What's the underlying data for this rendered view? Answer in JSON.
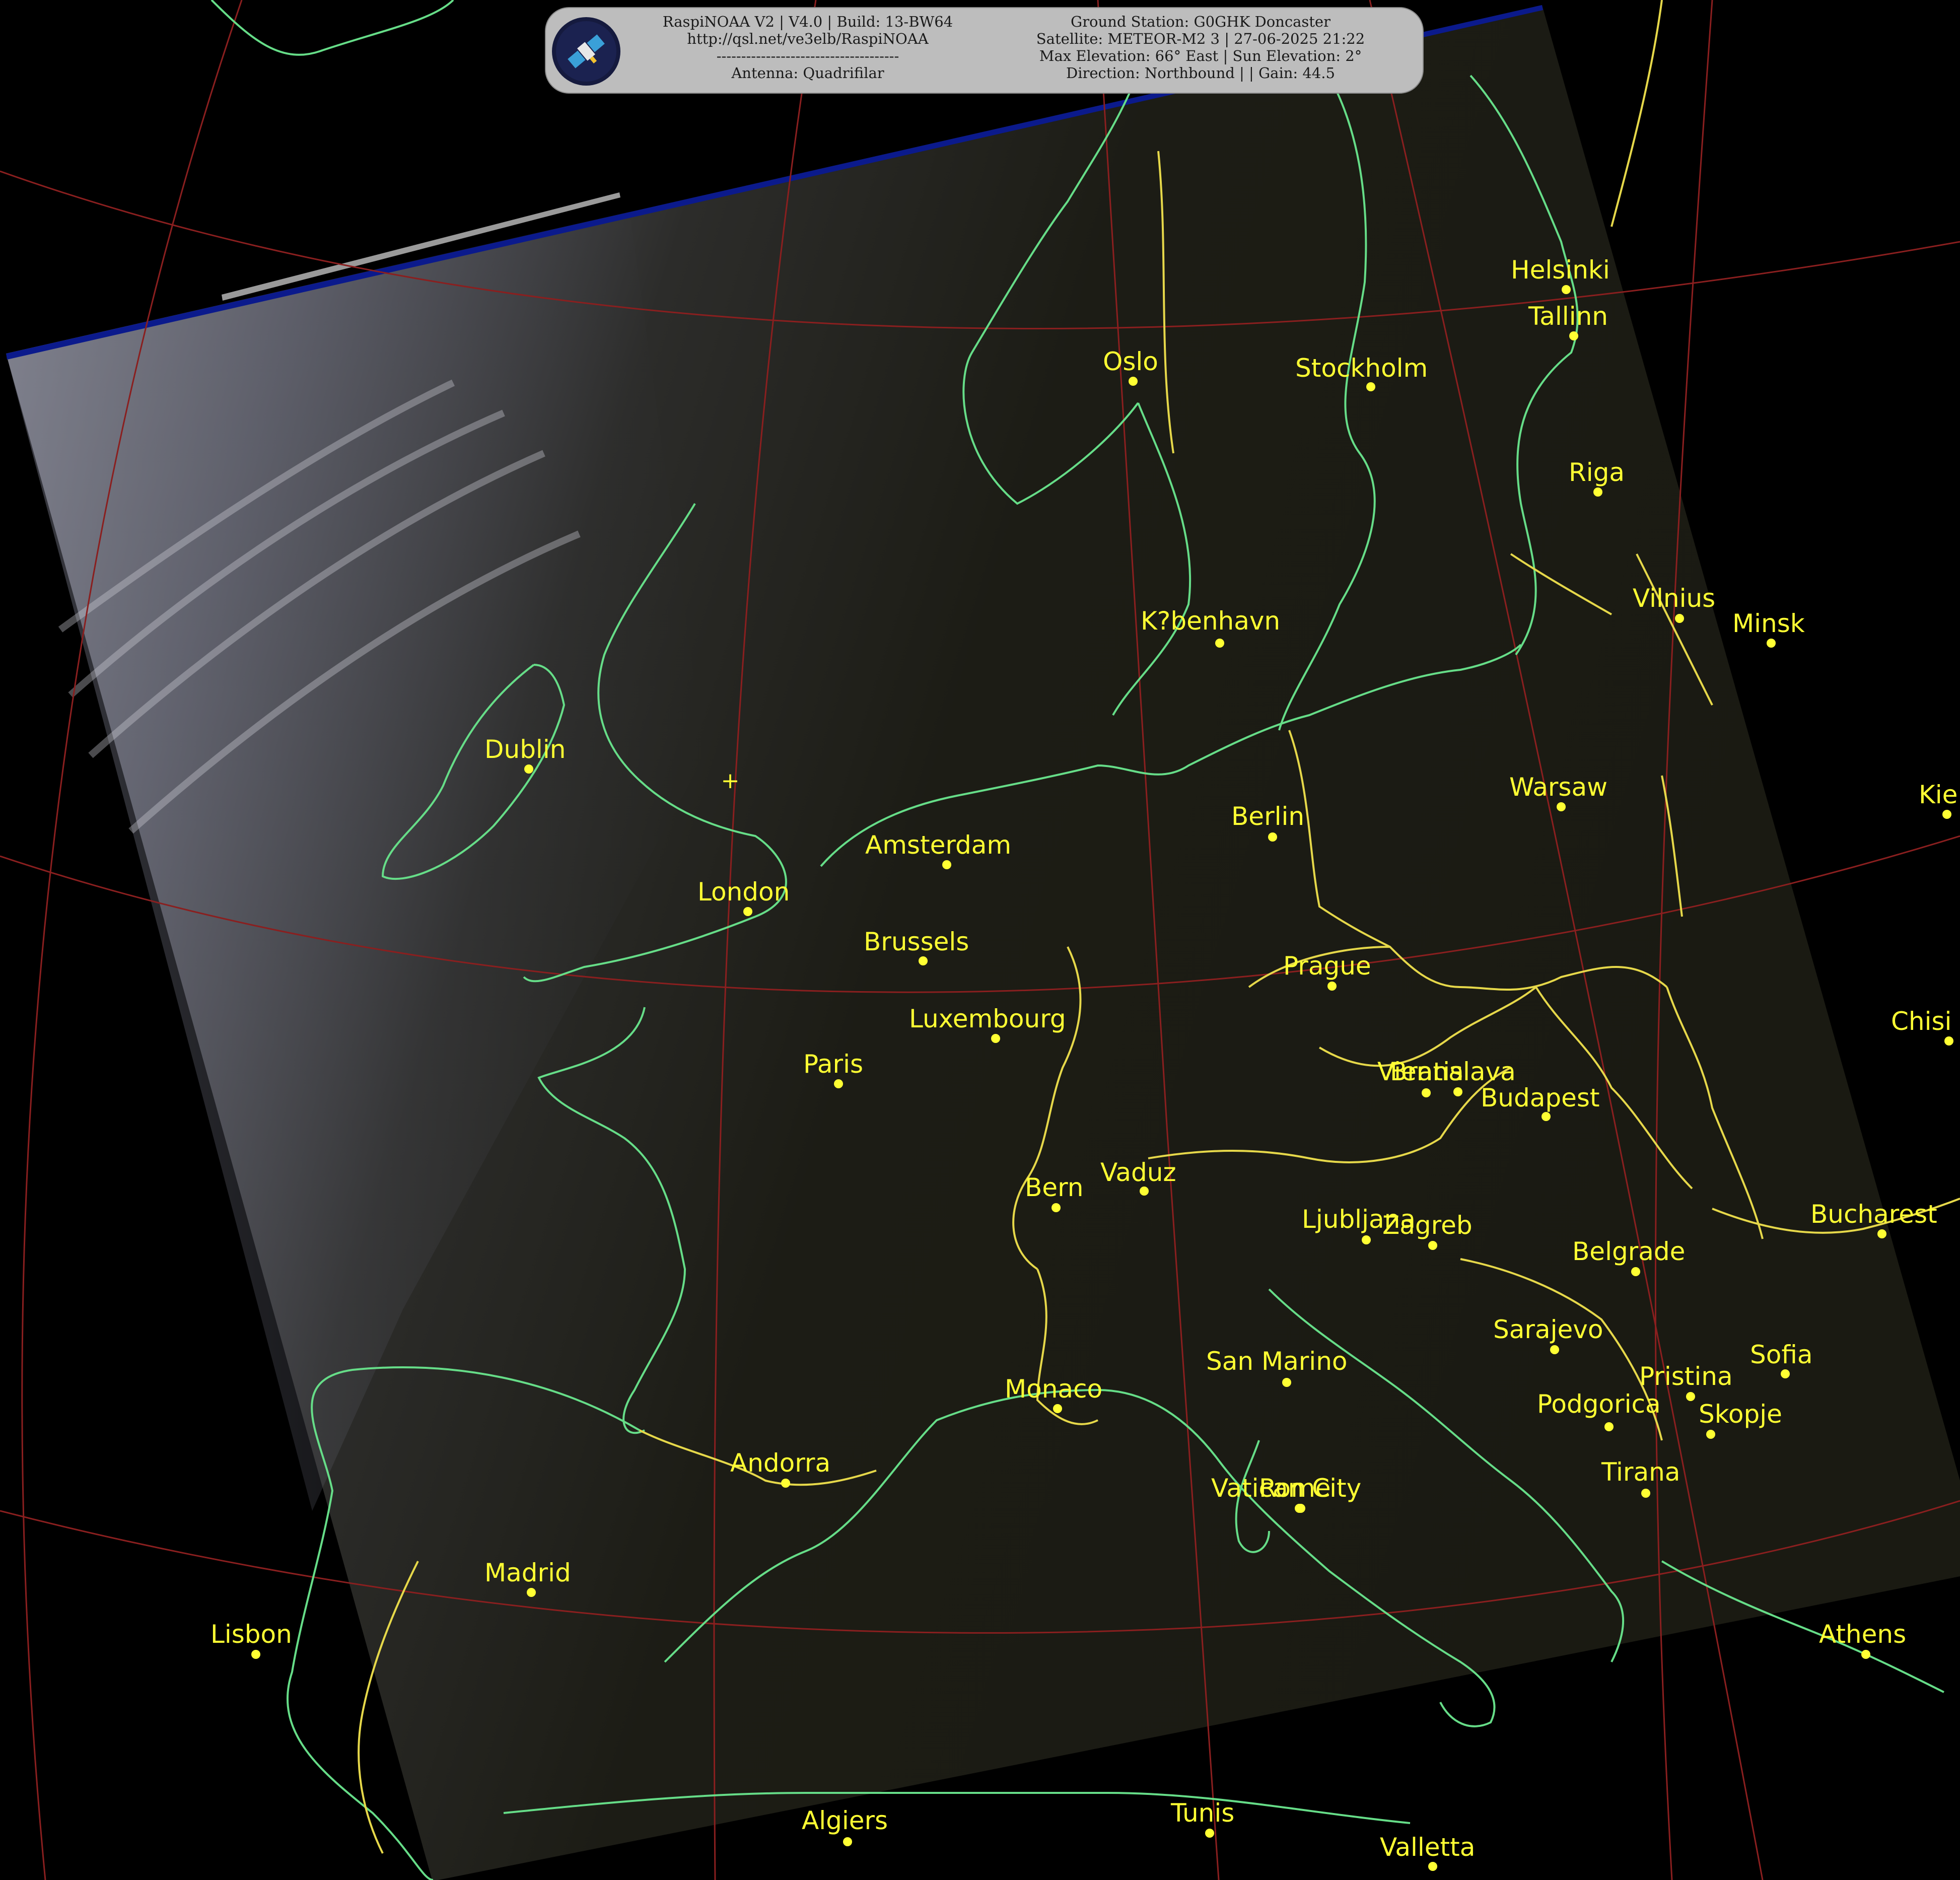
{
  "banner": {
    "left_lines": [
      "RaspiNOAA V2 | V4.0 | Build: 13-BW64",
      "http://qsl.net/ve3elb/RaspiNOAA",
      "-------------------------------------",
      "Antenna: Quadrifilar"
    ],
    "right_lines": [
      "Ground Station: G0GHK Doncaster",
      "Satellite: METEOR-M2 3 | 27-06-2025 21:22",
      "Max Elevation: 66° East | Sun Elevation: 2°",
      "Direction: Northbound | | Gain: 44.5"
    ],
    "logo_icon": "satellite-icon"
  },
  "colors": {
    "city": "#ffff33",
    "coastline": "#66dd88",
    "border": "#e6d84a",
    "graticule": "#8a1f1f",
    "swath": "#1e1e14"
  },
  "marker": "+",
  "cities": [
    {
      "name": "Helsinki"
    },
    {
      "name": "Tallinn"
    },
    {
      "name": "Oslo"
    },
    {
      "name": "Stockholm"
    },
    {
      "name": "Riga"
    },
    {
      "name": "Vilnius"
    },
    {
      "name": "Minsk"
    },
    {
      "name": "K?benhavn"
    },
    {
      "name": "Dublin"
    },
    {
      "name": "Warsaw"
    },
    {
      "name": "Kie"
    },
    {
      "name": "Berlin"
    },
    {
      "name": "Amsterdam"
    },
    {
      "name": "London"
    },
    {
      "name": "Brussels"
    },
    {
      "name": "Prague"
    },
    {
      "name": "Luxembourg"
    },
    {
      "name": "Chisi"
    },
    {
      "name": "Paris"
    },
    {
      "name": "Vienna"
    },
    {
      "name": "Bratislava"
    },
    {
      "name": "Budapest"
    },
    {
      "name": "Vaduz"
    },
    {
      "name": "Bern"
    },
    {
      "name": "Bucharest"
    },
    {
      "name": "Ljubljana"
    },
    {
      "name": "Zagreb"
    },
    {
      "name": "Belgrade"
    },
    {
      "name": "Sarajevo"
    },
    {
      "name": "Sofia"
    },
    {
      "name": "San Marino"
    },
    {
      "name": "Pristina"
    },
    {
      "name": "Monaco"
    },
    {
      "name": "Podgorica"
    },
    {
      "name": "Skopje"
    },
    {
      "name": "Andorra"
    },
    {
      "name": "Tirana"
    },
    {
      "name": "Vatican City"
    },
    {
      "name": "Rome"
    },
    {
      "name": "Madrid"
    },
    {
      "name": "Lisbon"
    },
    {
      "name": "Athens"
    },
    {
      "name": "Algiers"
    },
    {
      "name": "Tunis"
    },
    {
      "name": "Valletta"
    }
  ]
}
